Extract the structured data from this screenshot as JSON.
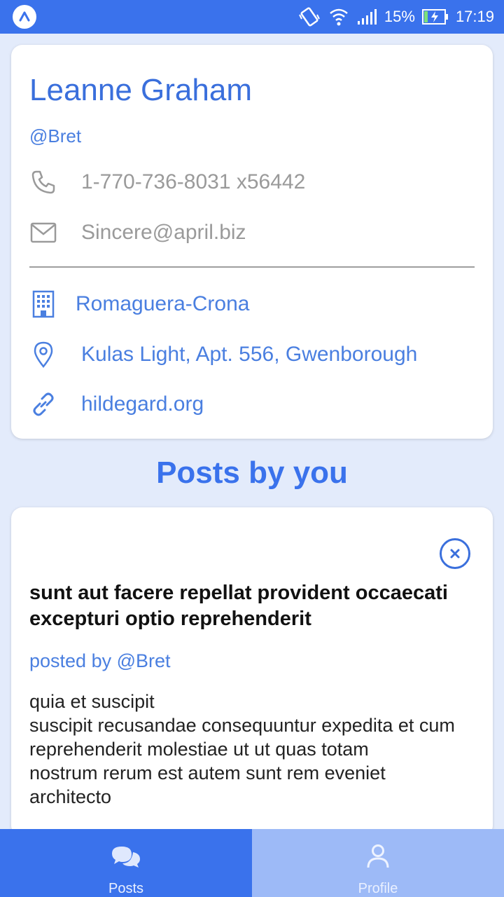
{
  "status": {
    "battery": "15%",
    "time": "17:19"
  },
  "profile": {
    "name": "Leanne Graham",
    "username": "@Bret",
    "phone": "1-770-736-8031 x56442",
    "email": "Sincere@april.biz",
    "company": "Romaguera-Crona",
    "address": "Kulas Light, Apt. 556, Gwenborough",
    "website": "hildegard.org"
  },
  "posts_section": {
    "title": "Posts by you"
  },
  "post": {
    "title": "sunt aut facere repellat provident occaecati excepturi optio reprehenderit",
    "author": "posted by @Bret",
    "body": "quia et suscipit\nsuscipit recusandae consequuntur expedita et cum\nreprehenderit molestiae ut ut quas totam\nnostrum rerum est autem sunt rem eveniet architecto"
  },
  "tabs": [
    {
      "label": "Posts",
      "icon": "chat-bubbles-icon"
    },
    {
      "label": "Profile",
      "icon": "person-icon"
    }
  ],
  "colors": {
    "primary": "#3a72ec",
    "tab_inactive": "#9dbaf7",
    "background": "#e3ebfb"
  }
}
